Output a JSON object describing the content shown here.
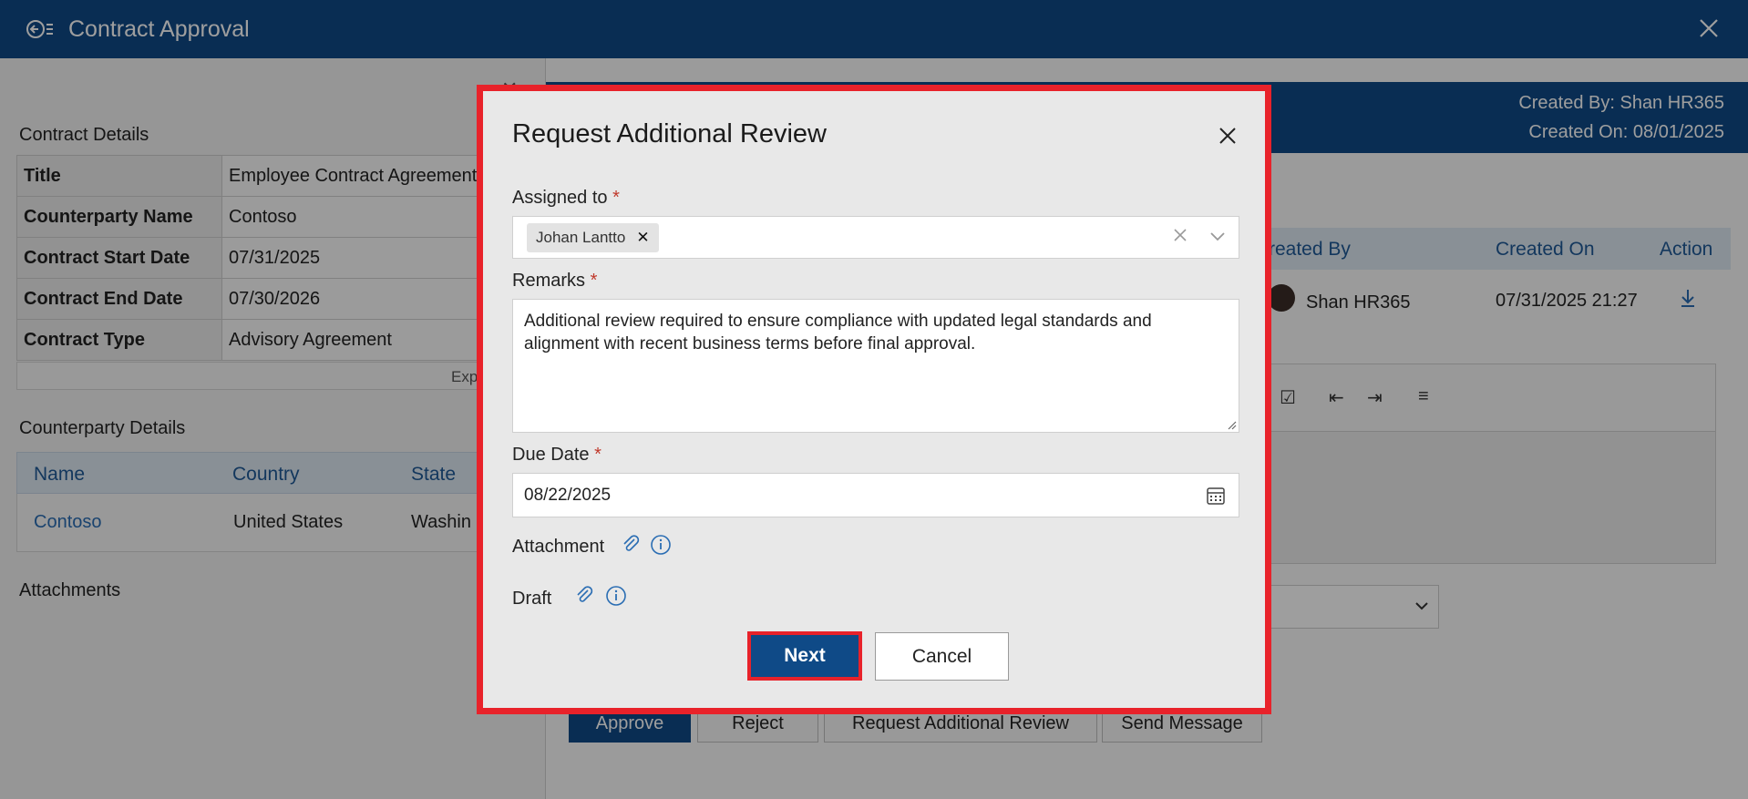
{
  "app": {
    "title": "Contract Approval"
  },
  "contract_details": {
    "heading": "Contract Details",
    "rows": [
      {
        "key": "Title",
        "value": "Employee Contract Agreement"
      },
      {
        "key": "Counterparty Name",
        "value": "Contoso"
      },
      {
        "key": "Contract Start Date",
        "value": "07/31/2025"
      },
      {
        "key": "Contract End Date",
        "value": "07/30/2026"
      },
      {
        "key": "Contract Type",
        "value": "Advisory Agreement"
      }
    ],
    "expand_label": "Exp"
  },
  "counterparty": {
    "heading": "Counterparty Details",
    "columns": [
      "Name",
      "Country",
      "State"
    ],
    "row": {
      "name": "Contoso",
      "country": "United States",
      "state": "Washin"
    }
  },
  "attachments": {
    "heading": "Attachments"
  },
  "right_header": {
    "created_by": "Created By: Shan HR365",
    "created_on": "Created On: 08/01/2025"
  },
  "history": {
    "columns": [
      "reated By",
      "Created On",
      "Action"
    ],
    "row": {
      "created_by": "Shan HR365",
      "created_on": "07/31/2025 21:27"
    }
  },
  "actions": {
    "approve": "Approve",
    "reject": "Reject",
    "request_review": "Request Additional Review",
    "send_message": "Send Message"
  },
  "modal": {
    "title": "Request Additional Review",
    "assigned_label": "Assigned to",
    "assigned_chip": "Johan Lantto",
    "remarks_label": "Remarks",
    "remarks_value": "Additional review required to ensure compliance with updated legal standards and alignment with recent business terms before final approval.",
    "due_date_label": "Due Date",
    "due_date_value": "08/22/2025",
    "attachment_label": "Attachment",
    "draft_label": "Draft",
    "required_mark": "*",
    "next_label": "Next",
    "cancel_label": "Cancel"
  },
  "icons": {
    "back": "back-menu-icon",
    "close": "close-icon",
    "calendar": "calendar-icon",
    "paperclip": "paperclip-icon",
    "info": "info-icon",
    "download": "download-icon",
    "chevron": "chevron-down-icon"
  },
  "colors": {
    "brand": "#0f4a87",
    "highlight": "#e8222a",
    "link": "#2a6db3",
    "required": "#c0392b"
  }
}
